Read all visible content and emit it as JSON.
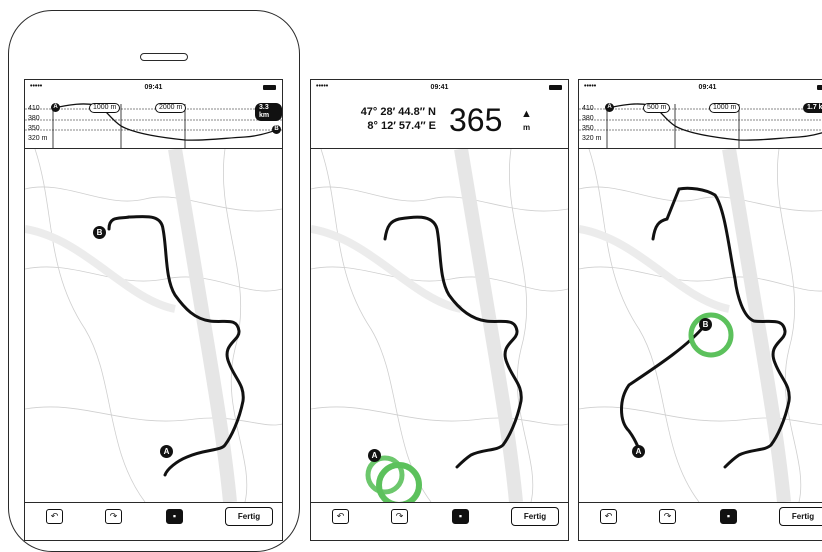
{
  "statusbar": {
    "dots": "•••••",
    "time": "09:41"
  },
  "screen1": {
    "elevation": {
      "ticks": [
        "410",
        "380",
        "350",
        "320 m"
      ],
      "distances": [
        "1000 m",
        "2000 m",
        "3.3 km"
      ],
      "start_marker": "A",
      "end_marker": "B"
    },
    "markers": {
      "start": "A",
      "end": "B"
    },
    "toolbar": {
      "undo_icon": "undo-arrow-icon",
      "redo_icon": "redo-arrow-icon",
      "comment_icon": "speech-bubble-icon",
      "done_label": "Fertig"
    }
  },
  "screen2": {
    "coordinates": {
      "lat": "47° 28′ 44.8″ N",
      "lon": "8° 12′ 57.4″ E"
    },
    "altitude": {
      "value": "365",
      "unit": "m",
      "icon": "mountain-icon"
    },
    "markers": {
      "start": "A"
    },
    "toolbar": {
      "done_label": "Fertig"
    }
  },
  "screen3": {
    "elevation": {
      "ticks": [
        "410",
        "380",
        "350",
        "320 m"
      ],
      "distances": [
        "500 m",
        "1000 m",
        "1.7 k"
      ],
      "start_marker": "A",
      "end_marker": "B"
    },
    "markers": {
      "start": "A",
      "end": "B"
    },
    "toolbar": {
      "done_label": "Fertig"
    }
  },
  "colors": {
    "route": "#111111",
    "highlight": "#5cc15c",
    "map_lines": "#c8c8c8",
    "river": "#e6e6e6"
  }
}
